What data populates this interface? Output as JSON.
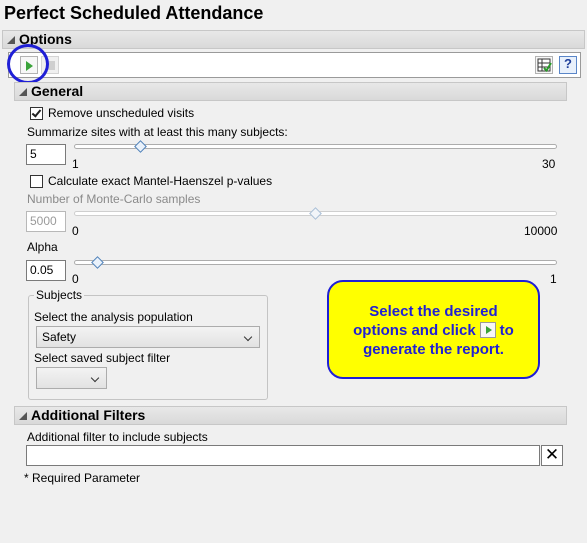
{
  "page_title": "Perfect Scheduled Attendance",
  "sections": {
    "options": "Options",
    "general": "General",
    "additional_filters": "Additional Filters"
  },
  "general": {
    "remove_unscheduled": {
      "label": "Remove unscheduled visits",
      "checked": true
    },
    "summarize_sites": {
      "label": "Summarize sites with at least this many subjects:",
      "value": "5",
      "min_label": "1",
      "max_label": "30",
      "slider_value": 5
    },
    "mantel_haenszel": {
      "label": "Calculate exact Mantel-Haenszel p-values",
      "checked": false
    },
    "monte_carlo": {
      "label": "Number of Monte-Carlo samples",
      "value": "5000",
      "min_label": "0",
      "max_label": "10000",
      "slider_value": 5000
    },
    "alpha": {
      "label": "Alpha",
      "value": "0.05",
      "min_label": "0",
      "max_label": "1",
      "slider_value": 0.05
    }
  },
  "subjects": {
    "title": "Subjects",
    "population_label": "Select the analysis population",
    "population_value": "Safety",
    "filter_label": "Select saved subject filter",
    "filter_value": ""
  },
  "callout": {
    "line1": "Select the desired",
    "line2a": "options and click",
    "line2b": "to",
    "line3": "generate the report."
  },
  "additional_filters": {
    "label": "Additional filter to include subjects",
    "value": "",
    "clear_glyph": "✕"
  },
  "required_note": "* Required Parameter",
  "toolbar": {
    "help_glyph": "?"
  },
  "colors": {
    "accent_blue": "#1f1fd6",
    "callout_yellow": "#ffff00",
    "run_green": "#3aa33a"
  },
  "icons": [
    "run-icon",
    "stop-icon",
    "data-filter-icon",
    "help-icon",
    "clear-icon",
    "dropdown-chevron-icon"
  ]
}
